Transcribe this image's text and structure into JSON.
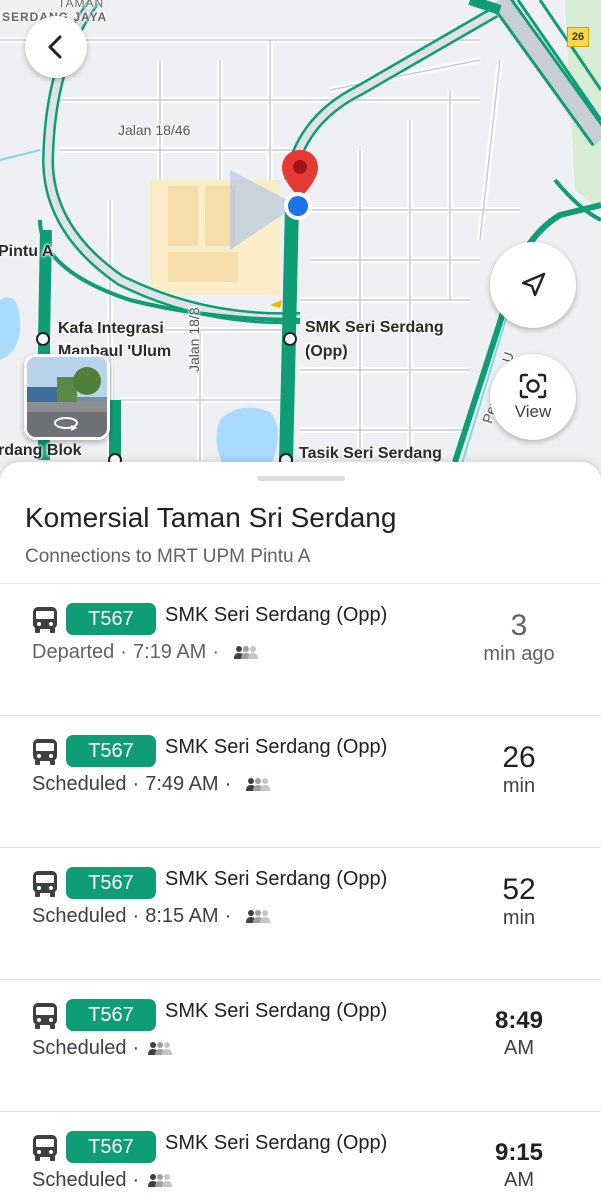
{
  "map": {
    "labels": {
      "area_top": "TAMAN",
      "area_name": "SERDANG JAYA",
      "road_18_46": "Jalan 18/46",
      "pintu_a": "Pintu A",
      "kafa_line1": "Kafa Integrasi",
      "kafa_line2": "Manbaul 'Ulum",
      "jalan_18_8": "Jalan 18/8",
      "smk_line1": "SMK Seri Serdang",
      "smk_line2": "(Opp)",
      "tasik": "Tasik Seri Serdang",
      "serdang_blok": "rdang Blok",
      "persiaran": "Persiaran U",
      "route_number": "26"
    },
    "view_button_label": "View",
    "colors": {
      "transit_line": "#0f9d76",
      "pin": "#e53935",
      "location_dot": "#1a73e8"
    }
  },
  "sheet": {
    "title": "Komersial Taman Sri Serdang",
    "subtitle": "Connections to MRT UPM Pintu A"
  },
  "departures": [
    {
      "route": "T567",
      "stop": "SMK Seri Serdang (Opp)",
      "status": "Departed",
      "time": "7:19 AM",
      "eta_main": "3",
      "eta_unit": "min ago"
    },
    {
      "route": "T567",
      "stop": "SMK Seri Serdang (Opp)",
      "status": "Scheduled",
      "time": "7:49 AM",
      "eta_main": "26",
      "eta_unit": "min"
    },
    {
      "route": "T567",
      "stop": "SMK Seri Serdang (Opp)",
      "status": "Scheduled",
      "time": "8:15 AM",
      "eta_main": "52",
      "eta_unit": "min"
    },
    {
      "route": "T567",
      "stop": "SMK Seri Serdang (Opp)",
      "status": "Scheduled",
      "time": "",
      "eta_main": "8:49",
      "eta_unit": "AM"
    },
    {
      "route": "T567",
      "stop": "SMK Seri Serdang (Opp)",
      "status": "Scheduled",
      "time": "",
      "eta_main": "9:15",
      "eta_unit": "AM"
    }
  ],
  "icons": {
    "back": "arrow-left-icon",
    "locate": "navigation-arrow-icon",
    "view": "camera-lens-icon",
    "bus": "bus-icon",
    "crowd": "crowd-level-icon",
    "pin": "map-pin-icon"
  }
}
